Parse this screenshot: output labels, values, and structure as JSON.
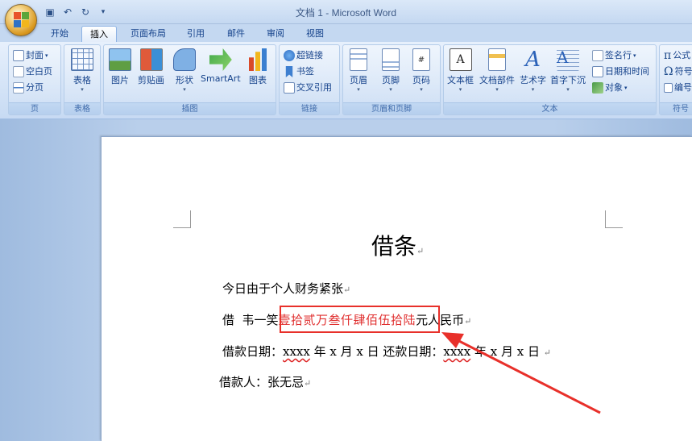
{
  "window": {
    "title": "文档 1 - Microsoft Word"
  },
  "tabs": [
    "开始",
    "插入",
    "页面布局",
    "引用",
    "邮件",
    "审阅",
    "视图"
  ],
  "active_tab": "插入",
  "ribbon": {
    "pages": {
      "label": "页",
      "cover": "封面",
      "blank": "空白页",
      "break": "分页"
    },
    "table": {
      "label": "表格",
      "btn": "表格"
    },
    "illustrations": {
      "label": "插图",
      "picture": "图片",
      "clipart": "剪贴画",
      "shapes": "形状",
      "smartart": "SmartArt",
      "chart": "图表"
    },
    "links": {
      "label": "链接",
      "hyperlink": "超链接",
      "bookmark": "书签",
      "crossref": "交叉引用"
    },
    "header_footer": {
      "label": "页眉和页脚",
      "header": "页眉",
      "footer": "页脚",
      "pagenum": "页码"
    },
    "text": {
      "label": "文本",
      "textbox": "文本框",
      "quickparts": "文档部件",
      "wordart": "艺术字",
      "dropcap": "首字下沉",
      "signature": "签名行",
      "datetime": "日期和时间",
      "object": "对象"
    },
    "symbols": {
      "label": "符号",
      "equation": "公式",
      "symbol": "符号",
      "number": "编号"
    }
  },
  "document": {
    "title": "借条",
    "line1": "今日由于个人财务紧张",
    "line2_prefix": "借  韦一笑",
    "line2_amount": "壹拾贰万叁仟肆佰伍拾陆",
    "line2_suffix": "元人民币",
    "line3_a": "借款日期：",
    "line3_x1": "xxxx",
    "line3_b": " 年 x 月 x 日 还款日期：",
    "line3_x2": "xxxx",
    "line3_c": " 年 x 月 x 日 ",
    "line4": "借款人：张无忌",
    "para_mark": "↵"
  },
  "colors": {
    "annotation": "#e8302a",
    "amount_text": "#e03030"
  }
}
